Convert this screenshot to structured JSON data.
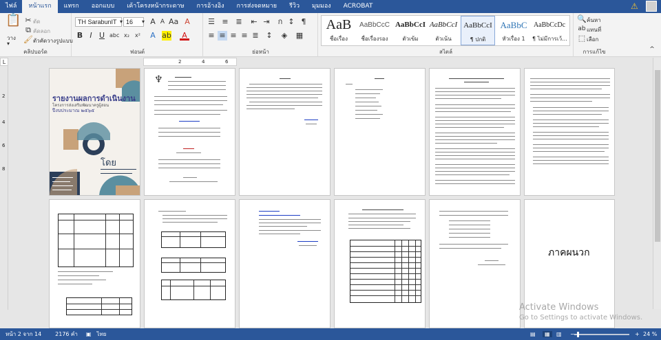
{
  "tabs": [
    "ไฟล์",
    "หน้าแรก",
    "แทรก",
    "ออกแบบ",
    "เค้าโครงหน้ากระดาษ",
    "การอ้างอิง",
    "การส่งจดหมาย",
    "รีวิว",
    "มุมมอง",
    "ACROBAT"
  ],
  "clipboard": {
    "paste": "วาง",
    "cut": "ตัด",
    "copy": "คัดลอก",
    "format_painter": "ตัวคัดวางรูปแบบ",
    "label": "คลิปบอร์ด"
  },
  "font": {
    "name": "TH SarabunIT",
    "size": "16",
    "label": "ฟอนต์"
  },
  "paragraph": {
    "label": "ย่อหน้า"
  },
  "styles": {
    "label": "สไตล์",
    "items": [
      {
        "sample": "AaB",
        "name": "ชื่อเรื่อง"
      },
      {
        "sample": "AaBbCcC",
        "name": "ชื่อเรื่องรอง"
      },
      {
        "sample": "AaBbCcI",
        "name": "ตัวเข้ม"
      },
      {
        "sample": "AaBbCcI",
        "name": "ตัวเน้น"
      },
      {
        "sample": "AaBbCcI",
        "name": "¶ ปกติ"
      },
      {
        "sample": "AaBbC",
        "name": "หัวเรื่อง 1"
      },
      {
        "sample": "AaBbCcDc",
        "name": "¶ ไม่มีการเว้..."
      }
    ]
  },
  "editing": {
    "find": "ค้นหา",
    "replace": "แทนที่",
    "select": "เลือก",
    "label": "การแก้ไข"
  },
  "ruler": {
    "h_marks": [
      "2",
      "4",
      "6"
    ],
    "v_marks": [
      "2",
      "4",
      "6",
      "8"
    ]
  },
  "cover": {
    "line1": "รายงานผลการดำเนินงาน",
    "line2": "โครงการส่งเสริมพัฒนาครูผู้สอน",
    "line3": "ปีงบประมาณ ๒๕๖๕",
    "by": "โดย"
  },
  "appendix_title": "ภาคผนวก",
  "watermark": {
    "title": "Activate Windows",
    "subtitle": "Go to Settings to activate Windows."
  },
  "status": {
    "page": "หน้า 2 จาก 14",
    "words": "2176 คำ",
    "language": "ไทย",
    "zoom": "24 %"
  },
  "colors": {
    "ribbon_blue": "#2b579a",
    "cover_brown": "#c8a27a",
    "cover_teal": "#5b8fa0",
    "cover_dark": "#2c3f59"
  }
}
